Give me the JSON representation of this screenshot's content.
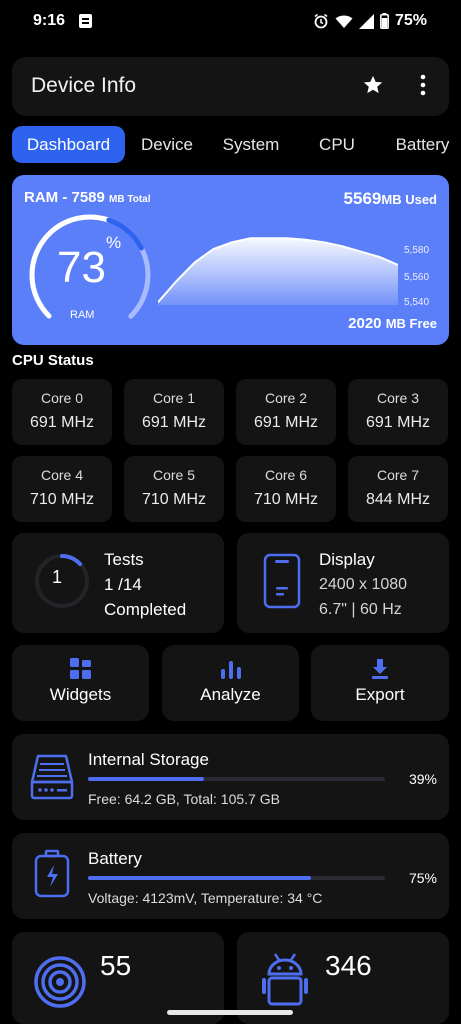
{
  "statusbar": {
    "time": "9:16",
    "battery": "75%"
  },
  "appbar": {
    "title": "Device Info"
  },
  "tabs": [
    "Dashboard",
    "Device",
    "System",
    "CPU",
    "Battery"
  ],
  "ram": {
    "title": "RAM - 7589",
    "title_unit": "MB Total",
    "used_value": "5569",
    "used_unit": "MB Used",
    "percent": "73",
    "percent_sign": "%",
    "label": "RAM",
    "free_value": "2020",
    "free_unit": "MB Free",
    "gauge_fraction": 0.73,
    "y_ticks": [
      "5,580",
      "5,560",
      "5,540"
    ]
  },
  "ram_chart_data": {
    "type": "area",
    "ylim": [
      5530,
      5590
    ],
    "y_ticks": [
      5580,
      5560,
      5540
    ],
    "values": [
      5532,
      5548,
      5562,
      5572,
      5577,
      5580,
      5580,
      5580,
      5579,
      5577,
      5574,
      5570,
      5566,
      5560
    ]
  },
  "cpu_status": {
    "title": "CPU Status",
    "cores": [
      {
        "name": "Core 0",
        "value": "691 MHz"
      },
      {
        "name": "Core 1",
        "value": "691 MHz"
      },
      {
        "name": "Core 2",
        "value": "691 MHz"
      },
      {
        "name": "Core 3",
        "value": "691 MHz"
      },
      {
        "name": "Core 4",
        "value": "710 MHz"
      },
      {
        "name": "Core 5",
        "value": "710 MHz"
      },
      {
        "name": "Core 6",
        "value": "710 MHz"
      },
      {
        "name": "Core 7",
        "value": "844 MHz"
      }
    ]
  },
  "tests": {
    "count": "1",
    "label": "Tests",
    "progress": "1 /14",
    "status": "Completed"
  },
  "display": {
    "label": "Display",
    "resolution": "2400 x 1080",
    "spec": "6.7\" | 60 Hz"
  },
  "actions": {
    "widgets": "Widgets",
    "analyze": "Analyze",
    "export": "Export"
  },
  "storage": {
    "title": "Internal Storage",
    "percent": "39%",
    "fraction": 0.39,
    "detail": "Free: 64.2 GB,  Total: 105.7 GB"
  },
  "battery": {
    "title": "Battery",
    "percent": "75%",
    "fraction": 0.75,
    "detail": "Voltage: 4123mV,  Temperature: 34 °C"
  },
  "sensors": {
    "count": "55"
  },
  "apps": {
    "count": "346"
  },
  "colors": {
    "accent": "#2d63ee",
    "ram_card": "#5b7ff9",
    "card": "#141414",
    "bar": "#4e6ef0"
  }
}
